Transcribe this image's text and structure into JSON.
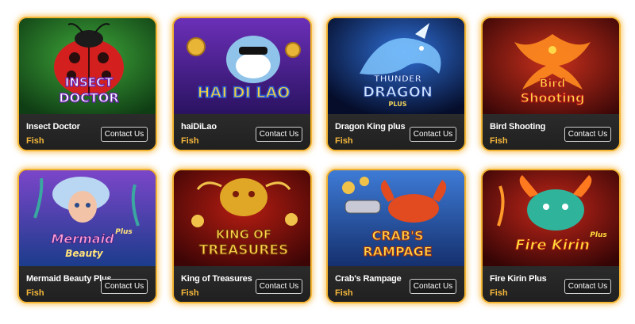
{
  "games": [
    {
      "name": "Insect Doctor",
      "category": "Fish",
      "button_label": "Contact Us",
      "logo_lines": [
        "INSECT",
        "DOCTOR"
      ],
      "icon": "ladybug-icon"
    },
    {
      "name": "haiDiLao",
      "category": "Fish",
      "button_label": "Contact Us",
      "logo_lines": [
        "HAI DI LAO"
      ],
      "icon": "shark-icon"
    },
    {
      "name": "Dragon King plus",
      "category": "Fish",
      "button_label": "Contact Us",
      "logo_lines": [
        "THUNDER",
        "DRAGON",
        "PLUS"
      ],
      "icon": "dragon-icon"
    },
    {
      "name": "Bird Shooting",
      "category": "Fish",
      "button_label": "Contact Us",
      "logo_lines": [
        "Bird",
        "Shooting"
      ],
      "icon": "phoenix-icon"
    },
    {
      "name": "Mermaid Beauty Plus",
      "category": "Fish",
      "button_label": "Contact Us",
      "logo_lines": [
        "Mermaid",
        "Beauty",
        "Plus"
      ],
      "icon": "mermaid-icon"
    },
    {
      "name": "King of Treasures",
      "category": "Fish",
      "button_label": "Contact Us",
      "logo_lines": [
        "KING OF",
        "TREASURES"
      ],
      "icon": "golden-dragon-icon"
    },
    {
      "name": "Crab's Rampage",
      "category": "Fish",
      "button_label": "Contact Us",
      "logo_lines": [
        "CRAB'S",
        "RAMPAGE"
      ],
      "icon": "crab-icon"
    },
    {
      "name": "Fire Kirin Plus",
      "category": "Fish",
      "button_label": "Contact Us",
      "logo_lines": [
        "Fire Kirin",
        "Plus"
      ],
      "icon": "kirin-icon"
    }
  ]
}
